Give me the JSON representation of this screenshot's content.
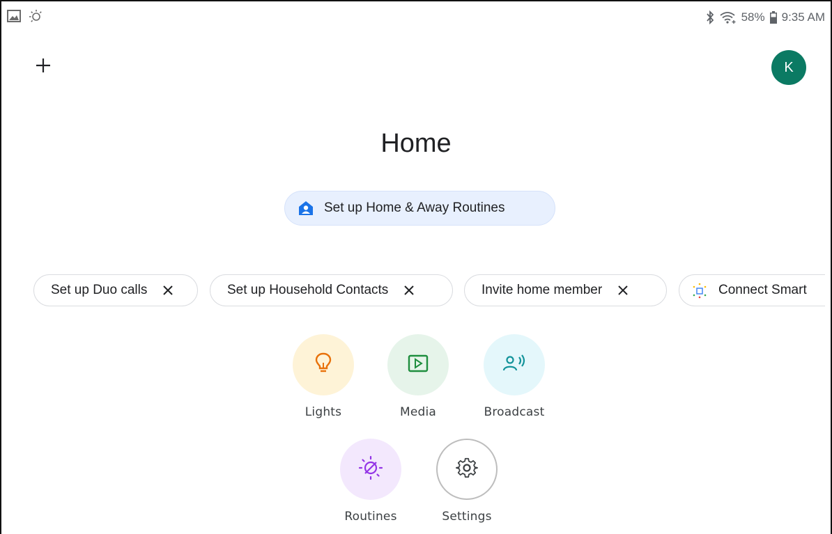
{
  "status_bar": {
    "left_icons": [
      "gallery-icon",
      "brightness-auto-icon"
    ],
    "right_icons": [
      "bluetooth-icon",
      "wifi-icon",
      "battery-icon"
    ],
    "battery": "58%",
    "time": "9:35 AM"
  },
  "header": {
    "add_icon": "plus-icon",
    "avatar_letter": "K",
    "avatar_color": "#0b7a63"
  },
  "title": "Home",
  "setup_banner": {
    "label": "Set up Home & Away Routines",
    "icon": "home-person-icon",
    "background": "#e8f0fe"
  },
  "chips": [
    {
      "label": "Set up Duo calls",
      "dismiss_icon": "close-icon"
    },
    {
      "label": "Set up Household Contacts",
      "dismiss_icon": "close-icon"
    },
    {
      "label": "Invite home member",
      "dismiss_icon": "close-icon"
    },
    {
      "label": "Connect Smart",
      "icon": "smart-device-icon"
    }
  ],
  "actions": [
    {
      "label": "Lights",
      "icon": "lightbulb-icon",
      "bg": "#fef3d7",
      "fg": "#e8710a"
    },
    {
      "label": "Media",
      "icon": "play-icon",
      "bg": "#e6f4ea",
      "fg": "#1e8e3e"
    },
    {
      "label": "Broadcast",
      "icon": "broadcast-icon",
      "bg": "#e4f7fb",
      "fg": "#12939a"
    },
    {
      "label": "Routines",
      "icon": "routines-icon",
      "bg": "#f3e8fd",
      "fg": "#9334e6"
    },
    {
      "label": "Settings",
      "icon": "gear-icon",
      "bg": "#ffffff",
      "fg": "#3c4043"
    }
  ]
}
